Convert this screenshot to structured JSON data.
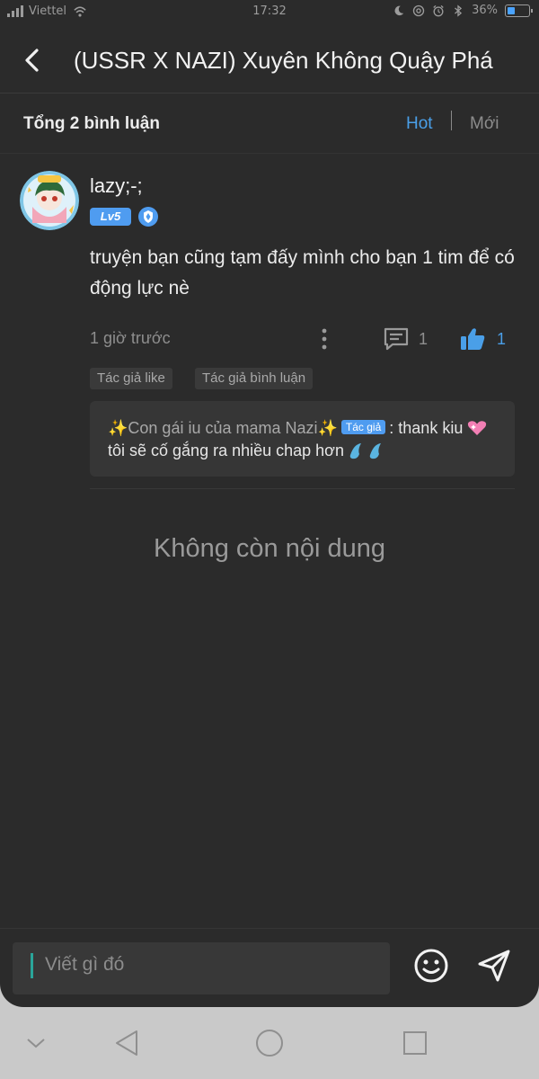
{
  "status_bar": {
    "carrier": "Viettel",
    "time": "17:32",
    "battery_percent": "36%",
    "battery_level": 0.36
  },
  "header": {
    "back_icon": "chevron-left-icon",
    "title": "(USSR X NAZI) Xuyên Không Quậy Phá"
  },
  "comments_bar": {
    "total_label": "Tổng 2 bình luận",
    "sort_hot": "Hot",
    "sort_new": "Mới",
    "active_color": "#4a9fe8"
  },
  "comment": {
    "username": "lazy;-;",
    "level": "Lv5",
    "text": "truyện bạn cũng tạm đấy mình cho bạn 1 tim để có động lực nè",
    "time_ago": "1 giờ trước",
    "reply_count": "1",
    "like_count": "1",
    "tags": [
      "Tác giả like",
      "Tác giả bình luận"
    ],
    "author_reply": {
      "author": "✨Con gái iu của mama Nazi✨",
      "author_tag": "Tác giả",
      "text_before": ": thank kiu ",
      "text_after": " tôi sẽ cố gắng ra nhiều chap hơn "
    }
  },
  "empty_state": "Không còn nội dung",
  "input_bar": {
    "placeholder": "Viết gì đó",
    "emoji_icon": "smiley-icon",
    "send_icon": "send-icon"
  },
  "nav_bar": {
    "icons": [
      "chevron-down-icon",
      "back-triangle-icon",
      "home-circle-icon",
      "recents-square-icon"
    ]
  }
}
